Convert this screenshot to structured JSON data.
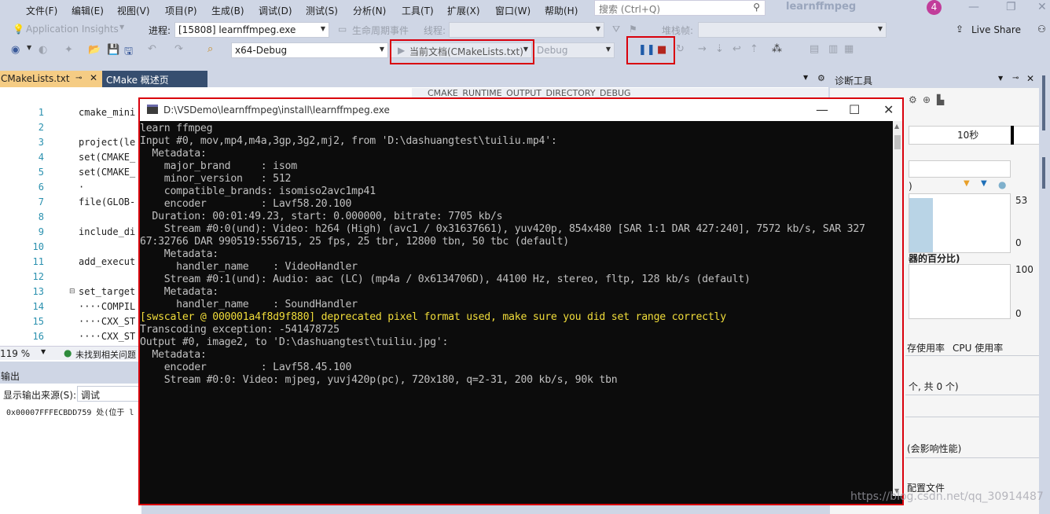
{
  "menu": [
    "文件(F)",
    "编辑(E)",
    "视图(V)",
    "项目(P)",
    "生成(B)",
    "调试(D)",
    "测试(S)",
    "分析(N)",
    "工具(T)",
    "扩展(X)",
    "窗口(W)",
    "帮助(H)"
  ],
  "search": {
    "placeholder": "搜索 (Ctrl+Q)"
  },
  "app_title": "learnffmpeg",
  "notification_count": "4",
  "toolbar1": {
    "insights": "Application Insights",
    "process_label": "进程:",
    "process_value": "[15808] learnffmpeg.exe",
    "lifecycle": "生命周期事件",
    "thread_label": "线程:",
    "stackframe_label": "堆栈帧:",
    "live_share": "Live Share"
  },
  "toolbar2": {
    "config": "x64-Debug",
    "current_doc": "当前文档(CMakeLists.txt)",
    "debug": "Debug"
  },
  "tabs": {
    "active": "CMakeLists.txt",
    "second": "CMake 概述页",
    "overflow_hint": "CMAKE_RUNTIME_OUTPUT_DIRECTORY_DEBUG"
  },
  "editor": {
    "lines": [
      {
        "n": "1",
        "text": "cmake_mini"
      },
      {
        "n": "2",
        "text": ""
      },
      {
        "n": "3",
        "text": "project(le"
      },
      {
        "n": "4",
        "text": "set(CMAKE_"
      },
      {
        "n": "5",
        "text": "set(CMAKE_"
      },
      {
        "n": "6",
        "text": "·"
      },
      {
        "n": "7",
        "text": "file(GLOB-"
      },
      {
        "n": "8",
        "text": ""
      },
      {
        "n": "9",
        "text": "include_di"
      },
      {
        "n": "10",
        "text": ""
      },
      {
        "n": "11",
        "text": "add_execut"
      },
      {
        "n": "12",
        "text": ""
      },
      {
        "n": "13",
        "text": "set_target"
      },
      {
        "n": "14",
        "text": "····COMPIL"
      },
      {
        "n": "15",
        "text": "····CXX_ST"
      },
      {
        "n": "16",
        "text": "····CXX_ST"
      }
    ],
    "zoom": "119 %",
    "issues": "未找到相关问题"
  },
  "output": {
    "title": "输出",
    "source_label": "显示输出来源(S):",
    "source_value": "调试",
    "line": "0x00007FFFECBDD759 处(位于 l"
  },
  "diagnostics": {
    "title": "诊断工具",
    "time_label": "10秒",
    "axis_top": "53",
    "axis_zero1": "0",
    "section_label": "器的百分比)",
    "axis_100": "100",
    "axis_zero2": "0",
    "tab_memory": "存使用率",
    "tab_cpu": "CPU 使用率",
    "count_text": "个, 共 0 个)",
    "perf_text": "(会影响性能)",
    "profile_text": "配置文件"
  },
  "console": {
    "title": "D:\\VSDemo\\learnffmpeg\\install\\learnffmpeg.exe",
    "lines": [
      {
        "t": "learn ffmpeg",
        "warn": false
      },
      {
        "t": "Input #0, mov,mp4,m4a,3gp,3g2,mj2, from 'D:\\dashuangtest\\tuiliu.mp4':",
        "warn": false
      },
      {
        "t": "  Metadata:",
        "warn": false
      },
      {
        "t": "    major_brand     : isom",
        "warn": false
      },
      {
        "t": "    minor_version   : 512",
        "warn": false
      },
      {
        "t": "    compatible_brands: isomiso2avc1mp41",
        "warn": false
      },
      {
        "t": "    encoder         : Lavf58.20.100",
        "warn": false
      },
      {
        "t": "  Duration: 00:01:49.23, start: 0.000000, bitrate: 7705 kb/s",
        "warn": false
      },
      {
        "t": "    Stream #0:0(und): Video: h264 (High) (avc1 / 0x31637661), yuv420p, 854x480 [SAR 1:1 DAR 427:240], 7572 kb/s, SAR 327",
        "warn": false
      },
      {
        "t": "67:32766 DAR 990519:556715, 25 fps, 25 tbr, 12800 tbn, 50 tbc (default)",
        "warn": false
      },
      {
        "t": "    Metadata:",
        "warn": false
      },
      {
        "t": "      handler_name    : VideoHandler",
        "warn": false
      },
      {
        "t": "    Stream #0:1(und): Audio: aac (LC) (mp4a / 0x6134706D), 44100 Hz, stereo, fltp, 128 kb/s (default)",
        "warn": false
      },
      {
        "t": "    Metadata:",
        "warn": false
      },
      {
        "t": "      handler_name    : SoundHandler",
        "warn": false
      },
      {
        "t": "[swscaler @ 000001a4f8d9f880] deprecated pixel format used, make sure you did set range correctly",
        "warn": true
      },
      {
        "t": "Transcoding exception: -541478725",
        "warn": false
      },
      {
        "t": "Output #0, image2, to 'D:\\dashuangtest\\tuiliu.jpg':",
        "warn": false
      },
      {
        "t": "  Metadata:",
        "warn": false
      },
      {
        "t": "    encoder         : Lavf58.45.100",
        "warn": false
      },
      {
        "t": "    Stream #0:0: Video: mjpeg, yuvj420p(pc), 720x180, q=2-31, 200 kb/s, 90k tbn",
        "warn": false
      }
    ]
  },
  "watermark": "https://blog.csdn.net/qq_30914487"
}
